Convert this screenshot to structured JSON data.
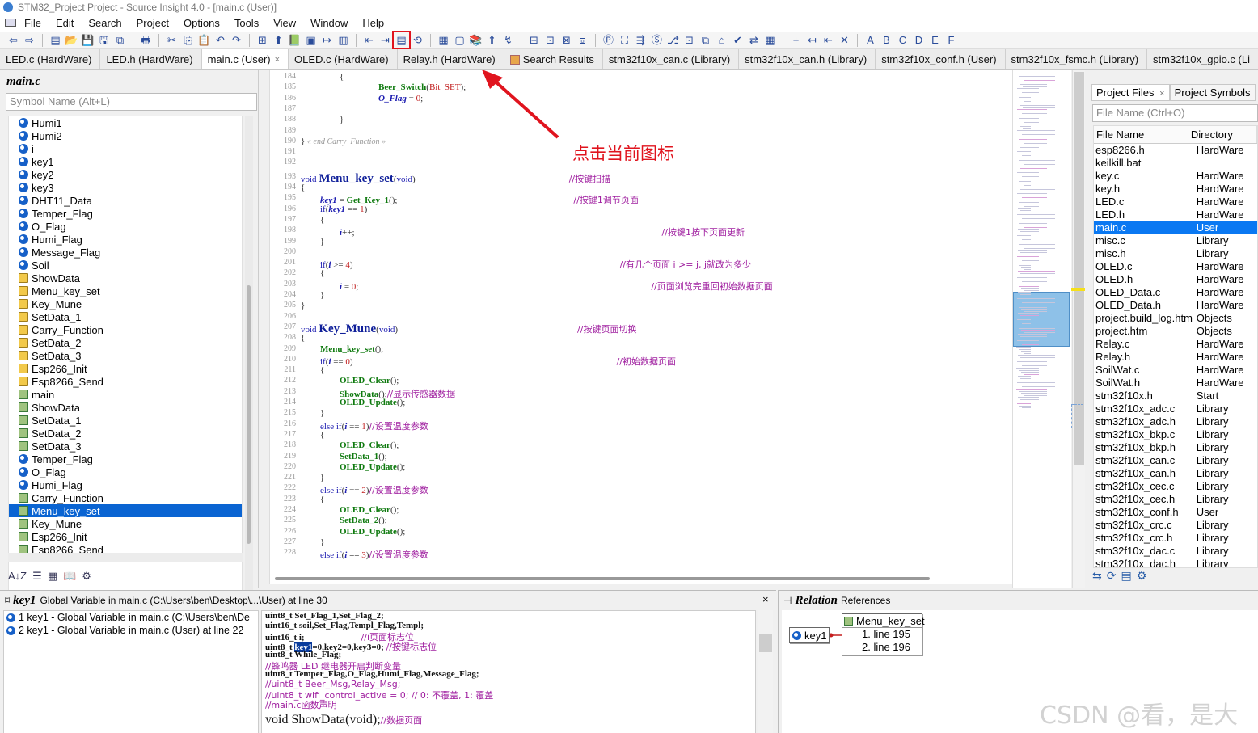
{
  "window": {
    "title": "STM32_Project Project - Source Insight 4.0 - [main.c (User)]"
  },
  "menubar": [
    "File",
    "Edit",
    "Search",
    "Project",
    "Options",
    "Tools",
    "View",
    "Window",
    "Help"
  ],
  "tabs": [
    {
      "label": "LED.c (HardWare)",
      "active": false
    },
    {
      "label": "LED.h (HardWare)",
      "active": false
    },
    {
      "label": "main.c (User)",
      "active": true,
      "close": "×"
    },
    {
      "label": "OLED.c (HardWare)",
      "active": false
    },
    {
      "label": "Relay.h (HardWare)",
      "active": false
    },
    {
      "label": "Search Results",
      "active": false
    },
    {
      "label": "stm32f10x_can.c (Library)",
      "active": false
    },
    {
      "label": "stm32f10x_can.h (Library)",
      "active": false
    },
    {
      "label": "stm32f10x_conf.h (User)",
      "active": false
    },
    {
      "label": "stm32f10x_fsmc.h (Library)",
      "active": false
    },
    {
      "label": "stm32f10x_gpio.c (Li",
      "active": false
    }
  ],
  "symbol_panel": {
    "title": "main.c",
    "search_placeholder": "Symbol Name (Alt+L)",
    "items": [
      {
        "label": "Humi1",
        "kind": "var"
      },
      {
        "label": "Humi2",
        "kind": "var"
      },
      {
        "label": "i",
        "kind": "var"
      },
      {
        "label": "key1",
        "kind": "var"
      },
      {
        "label": "key2",
        "kind": "var"
      },
      {
        "label": "key3",
        "kind": "var"
      },
      {
        "label": "DHT11_Data",
        "kind": "var"
      },
      {
        "label": "Temper_Flag",
        "kind": "var"
      },
      {
        "label": "O_Flag",
        "kind": "var"
      },
      {
        "label": "Humi_Flag",
        "kind": "var"
      },
      {
        "label": "Message_Flag",
        "kind": "var"
      },
      {
        "label": "Soil",
        "kind": "var"
      },
      {
        "label": "ShowData",
        "kind": "fold"
      },
      {
        "label": "Menu_key_set",
        "kind": "fold"
      },
      {
        "label": "Key_Mune",
        "kind": "fold"
      },
      {
        "label": "SetData_1",
        "kind": "fold"
      },
      {
        "label": "Carry_Function",
        "kind": "fold"
      },
      {
        "label": "SetData_2",
        "kind": "fold"
      },
      {
        "label": "SetData_3",
        "kind": "fold"
      },
      {
        "label": "Esp266_Init",
        "kind": "fold"
      },
      {
        "label": "Esp8266_Send",
        "kind": "fold"
      },
      {
        "label": "main",
        "kind": "func"
      },
      {
        "label": "ShowData",
        "kind": "func"
      },
      {
        "label": "SetData_1",
        "kind": "func"
      },
      {
        "label": "SetData_2",
        "kind": "func"
      },
      {
        "label": "SetData_3",
        "kind": "func"
      },
      {
        "label": "Temper_Flag",
        "kind": "var"
      },
      {
        "label": "O_Flag",
        "kind": "var"
      },
      {
        "label": "Humi_Flag",
        "kind": "var"
      },
      {
        "label": "Carry_Function",
        "kind": "func"
      },
      {
        "label": "Menu_key_set",
        "kind": "func",
        "selected": true
      },
      {
        "label": "Key_Mune",
        "kind": "func"
      },
      {
        "label": "Esp266_Init",
        "kind": "func"
      },
      {
        "label": "Esp8266_Send",
        "kind": "func"
      }
    ]
  },
  "editor": {
    "annotation": "点击当前图标",
    "lines": [
      {
        "n": "184",
        "html": "<span style='margin-left:48px'>{</span>"
      },
      {
        "n": "185",
        "html": "<span style='margin-left:96px' class='fn'>Beer_Switch</span>(<span class='num'>Bit_SET</span>);"
      },
      {
        "n": "186",
        "html": "<span style='margin-left:96px' class='var-b'>O_Flag</span> = <span class='num'>0</span>;"
      },
      {
        "n": "187",
        "html": ""
      },
      {
        "n": "188",
        "html": "<span style='margin-left:48px'>}</span>"
      },
      {
        "n": "189",
        "html": ""
      },
      {
        "n": "190",
        "html": "} <span class='dim'>« end Carry_Function »</span>"
      },
      {
        "n": "191",
        "html": ""
      },
      {
        "n": "192",
        "html": ""
      },
      {
        "n": "193",
        "html": "<span class='kw'>void</span> <span class='fnd'>Menu_key_set</span>(<span class='kw'>void</span>)<span class='cmt' style='margin-left:190px'>//按键扫描</span>"
      },
      {
        "n": "194",
        "html": "{"
      },
      {
        "n": "195",
        "html": "<span style='margin-left:24px' class='var-b'>key1</span> = <span class='fn'>Get_Key_1</span>();<span class='cmt' style='margin-left:218px'>//按键1调节页面</span>"
      },
      {
        "n": "196",
        "html": "<span style='margin-left:24px' class='kw'>if</span>(<span class='var-b'>key1</span> == <span class='num'>1</span>)"
      },
      {
        "n": "197",
        "html": "<span style='margin-left:24px'>{</span>"
      },
      {
        "n": "198",
        "html": "<span style='margin-left:48px' class='var-b'>i</span>++;<span class='cmt' style='margin-left:380px'>//按键1按下页面更新</span>"
      },
      {
        "n": "199",
        "html": "<span style='margin-left:24px'>}</span>"
      },
      {
        "n": "200",
        "html": ""
      },
      {
        "n": "201",
        "html": "<span style='margin-left:24px' class='kw'>if</span>(<span class='var-b'>i</span> &gt;= <span class='num'>4</span>)<span class='cmt' style='margin-left:330px'>//有几个页面 i &gt;= j, j就改为多少</span>"
      },
      {
        "n": "202",
        "html": "<span style='margin-left:24px'>{</span>"
      },
      {
        "n": "203",
        "html": "<span style='margin-left:48px' class='var-b'>i</span> = <span class='num'>0</span>;<span class='cmt' style='margin-left:362px'>//页面浏览完重回初始数据页面</span>"
      },
      {
        "n": "204",
        "html": "<span style='margin-left:24px'>}</span>"
      },
      {
        "n": "205",
        "html": "}"
      },
      {
        "n": "206",
        "html": ""
      },
      {
        "n": "207",
        "html": "<span class='kw'>void</span> <span class='fnd'>Key_Mune</span>(<span class='kw'>void</span>)<span class='cmt' style='margin-left:222px'>//按键页面切换</span>"
      },
      {
        "n": "208",
        "html": "{"
      },
      {
        "n": "209",
        "html": "<span style='margin-left:24px' class='fn'>Menu_key_set</span>();"
      },
      {
        "n": "210",
        "html": "<span style='margin-left:24px' class='kw'>if</span>(<span class='var-b'>i</span> == <span class='num'>0</span>)<span class='cmt' style='margin-left:326px'>//初始数据页面</span>"
      },
      {
        "n": "211",
        "html": "<span style='margin-left:24px'>{</span>"
      },
      {
        "n": "212",
        "html": "<span style='margin-left:48px' class='fn'>OLED_Clear</span>();"
      },
      {
        "n": "213",
        "html": "<span style='margin-left:48px' class='fn'>ShowData</span>();<span class='cmt'>//显示传感器数据</span>"
      },
      {
        "n": "214",
        "html": "<span style='margin-left:48px' class='fn'>OLED_Update</span>();"
      },
      {
        "n": "215",
        "html": "<span style='margin-left:24px'>}</span>"
      },
      {
        "n": "216",
        "html": "<span style='margin-left:24px' class='kw'>else if</span>(<span class='var-b'>i</span> == <span class='num'>1</span>)<span class='cmt'>//设置温度参数</span>"
      },
      {
        "n": "217",
        "html": "<span style='margin-left:24px'>{</span>"
      },
      {
        "n": "218",
        "html": "<span style='margin-left:48px' class='fn'>OLED_Clear</span>();"
      },
      {
        "n": "219",
        "html": "<span style='margin-left:48px' class='fn'>SetData_1</span>();"
      },
      {
        "n": "220",
        "html": "<span style='margin-left:48px' class='fn'>OLED_Update</span>();"
      },
      {
        "n": "221",
        "html": "<span style='margin-left:24px'>}</span>"
      },
      {
        "n": "222",
        "html": "<span style='margin-left:24px' class='kw'>else if</span>(<span class='var-b'>i</span> == <span class='num'>2</span>)<span class='cmt'>//设置温度参数</span>"
      },
      {
        "n": "223",
        "html": "<span style='margin-left:24px'>{</span>"
      },
      {
        "n": "224",
        "html": "<span style='margin-left:48px' class='fn'>OLED_Clear</span>();"
      },
      {
        "n": "225",
        "html": "<span style='margin-left:48px' class='fn'>SetData_2</span>();"
      },
      {
        "n": "226",
        "html": "<span style='margin-left:48px' class='fn'>OLED_Update</span>();"
      },
      {
        "n": "227",
        "html": "<span style='margin-left:24px'>}</span>"
      },
      {
        "n": "228",
        "html": "<span style='margin-left:24px' class='kw'>else if</span>(<span class='var-b'>i</span> == <span class='num'>3</span>)<span class='cmt'>//设置温度参数</span>"
      }
    ]
  },
  "project_panel": {
    "tabs": [
      "Project Files",
      "Project Symbols"
    ],
    "tab_close": "×",
    "search_placeholder": "File Name (Ctrl+O)",
    "columns": [
      "File Name",
      "Directory"
    ],
    "files": [
      [
        "esp8266.h",
        "HardWare"
      ],
      [
        "keilkill.bat",
        ""
      ],
      [
        "key.c",
        "HardWare"
      ],
      [
        "key.h",
        "HardWare"
      ],
      [
        "LED.c",
        "HardWare"
      ],
      [
        "LED.h",
        "HardWare"
      ],
      [
        "main.c",
        "User"
      ],
      [
        "misc.c",
        "Library"
      ],
      [
        "misc.h",
        "Library"
      ],
      [
        "OLED.c",
        "HardWare"
      ],
      [
        "OLED.h",
        "HardWare"
      ],
      [
        "OLED_Data.c",
        "HardWare"
      ],
      [
        "OLED_Data.h",
        "HardWare"
      ],
      [
        "project.build_log.htm",
        "Objects"
      ],
      [
        "project.htm",
        "Objects"
      ],
      [
        "Relay.c",
        "HardWare"
      ],
      [
        "Relay.h",
        "HardWare"
      ],
      [
        "SoilWat.c",
        "HardWare"
      ],
      [
        "SoilWat.h",
        "HardWare"
      ],
      [
        "stm32f10x.h",
        "Start"
      ],
      [
        "stm32f10x_adc.c",
        "Library"
      ],
      [
        "stm32f10x_adc.h",
        "Library"
      ],
      [
        "stm32f10x_bkp.c",
        "Library"
      ],
      [
        "stm32f10x_bkp.h",
        "Library"
      ],
      [
        "stm32f10x_can.c",
        "Library"
      ],
      [
        "stm32f10x_can.h",
        "Library"
      ],
      [
        "stm32f10x_cec.c",
        "Library"
      ],
      [
        "stm32f10x_cec.h",
        "Library"
      ],
      [
        "stm32f10x_conf.h",
        "User"
      ],
      [
        "stm32f10x_crc.c",
        "Library"
      ],
      [
        "stm32f10x_crc.h",
        "Library"
      ],
      [
        "stm32f10x_dac.c",
        "Library"
      ],
      [
        "stm32f10x_dac.h",
        "Library"
      ]
    ],
    "selected_index": 6
  },
  "context_panel": {
    "symbol": "key1",
    "info": "Global Variable in main.c (C:\\Users\\ben\\Desktop\\...\\User) at line 30",
    "close": "×",
    "refs": [
      "1 key1 - Global Variable in main.c (C:\\Users\\ben\\De",
      "2 key1 - Global Variable in main.c (User) at line 22"
    ],
    "code_lines": [
      {
        "html": "uint8_t Set_Flag_1,Set_Flag_2;"
      },
      {
        "html": "uint16_t soil,Set_Flag,Templ_Flag,Templ;"
      },
      {
        "html": "uint16_t i;<span class='cmt' style='margin-left:70px'>//i页面标志位</span>"
      },
      {
        "html": "uint8_t <span class='hl'>key1</span>=0,key2=0,key3=0; <span class='cmt'>//按键标志位</span>"
      },
      {
        "html": "uint8_t While_Flag;"
      },
      {
        "html": "<span class='cmt'>//蜂鸣器 LED 继电器开启判断变量</span>"
      },
      {
        "html": "uint8_t Temper_Flag,O_Flag,Humi_Flag,Message_Flag;"
      },
      {
        "html": "<span class='cmt'>//uint8_t Beer_Msg,Relay_Msg;</span>"
      },
      {
        "html": "<span class='cmt'>//uint8_t wifi_control_active = 0; // 0: 不覆盖, 1: 覆盖</span>"
      },
      {
        "html": "<span class='cmt'>//main.c函数声明</span>"
      },
      {
        "html": "void <span style='font-size:16px'>ShowData</span>(void);<span class='cmt'>//数据页面</span>",
        "big": true
      }
    ]
  },
  "relation_panel": {
    "title": "Relation",
    "subtitle": "References",
    "node": "key1",
    "target": "Menu_key_set",
    "lines": [
      "1. line 195",
      "2. line 196"
    ]
  },
  "watermark": "CSDN @看，是大狗",
  "colors": {
    "accent": "#e0141e",
    "selection": "#0a64d2"
  }
}
